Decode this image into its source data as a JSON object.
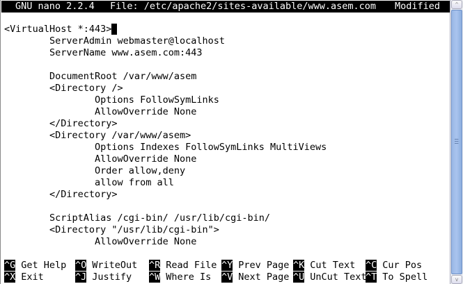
{
  "title_bar": {
    "app": "GNU nano 2.2.4",
    "file": "File: /etc/apache2/sites-available/www.asem.com",
    "status": "Modified"
  },
  "lines": [
    "<VirtualHost *:443>",
    "        ServerAdmin webmaster@localhost",
    "        ServerName www.asem.com:443",
    "",
    "        DocumentRoot /var/www/asem",
    "        <Directory />",
    "                Options FollowSymLinks",
    "                AllowOverride None",
    "        </Directory>",
    "        <Directory /var/www/asem>",
    "                Options Indexes FollowSymLinks MultiViews",
    "                AllowOverride None",
    "                Order allow,deny",
    "                allow from all",
    "        </Directory>",
    "",
    "        ScriptAlias /cgi-bin/ /usr/lib/cgi-bin/",
    "        <Directory \"/usr/lib/cgi-bin\">",
    "                AllowOverride None"
  ],
  "shortcuts": [
    [
      {
        "key": "^G",
        "label": "Get Help"
      },
      {
        "key": "^O",
        "label": "WriteOut"
      },
      {
        "key": "^R",
        "label": "Read File"
      },
      {
        "key": "^Y",
        "label": "Prev Page"
      },
      {
        "key": "^K",
        "label": "Cut Text"
      },
      {
        "key": "^C",
        "label": "Cur Pos"
      }
    ],
    [
      {
        "key": "^X",
        "label": "Exit"
      },
      {
        "key": "^J",
        "label": "Justify"
      },
      {
        "key": "^W",
        "label": "Where Is"
      },
      {
        "key": "^V",
        "label": "Next Page"
      },
      {
        "key": "^U",
        "label": "UnCut Text"
      },
      {
        "key": "^T",
        "label": "To Spell"
      }
    ]
  ]
}
